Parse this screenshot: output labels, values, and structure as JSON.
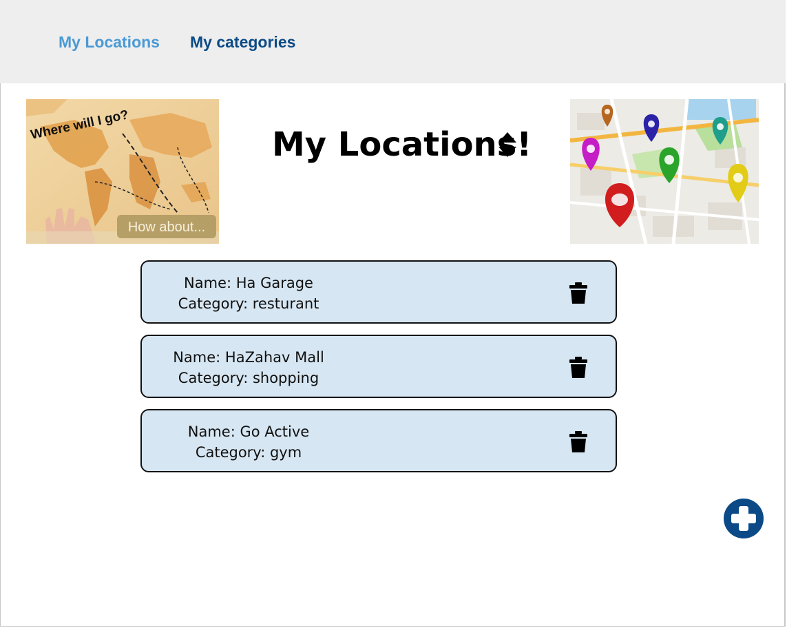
{
  "colors": {
    "accent_light": "#4a9ad4",
    "accent_dark": "#0b4a86",
    "card_bg": "#d6e6f2"
  },
  "nav": {
    "links": [
      {
        "label": "My Locations",
        "active": true
      },
      {
        "label": "My categories",
        "active": false
      }
    ]
  },
  "banner_left": {
    "icon": "world-map-image",
    "handwritten_title": "Where will I go?",
    "caption": "How about..."
  },
  "banner_right": {
    "icon": "map-pins-image"
  },
  "page": {
    "title": "My Locations!",
    "sort_icon": "sort-icon"
  },
  "locations": [
    {
      "name": "Name: Ha Garage",
      "category": "Category: resturant"
    },
    {
      "name": "Name: HaZahav Mall",
      "category": "Category: shopping"
    },
    {
      "name": "Name: Go Active",
      "category": "Category: gym"
    }
  ],
  "actions": {
    "delete_icon": "trash-icon",
    "add_icon": "plus-circle-icon"
  }
}
